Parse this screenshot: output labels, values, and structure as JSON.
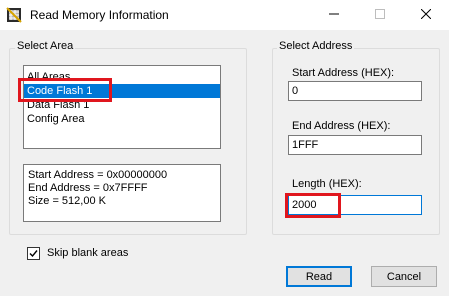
{
  "window": {
    "title": "Read Memory Information"
  },
  "select_area": {
    "title": "Select Area",
    "items": [
      {
        "label": "All Areas"
      },
      {
        "label": "Code Flash 1"
      },
      {
        "label": "Data Flash 1"
      },
      {
        "label": "Config Area"
      }
    ],
    "selected": "Code Flash 1",
    "info_lines": [
      "Start Address = 0x00000000",
      "End Address = 0x7FFFF",
      "Size = 512,00 K"
    ]
  },
  "select_address": {
    "title": "Select Address",
    "fields": [
      {
        "label": "Start Address (HEX):",
        "value": "0"
      },
      {
        "label": "End Address (HEX):",
        "value": "1FFF"
      },
      {
        "label": "Length (HEX):",
        "value": "2000"
      }
    ]
  },
  "options": {
    "skip_blank_label": "Skip blank areas",
    "skip_blank_checked": true
  },
  "buttons": {
    "read_label": "Read",
    "cancel_label": "Cancel"
  },
  "colors": {
    "selection": "#0078d7",
    "highlight": "#e0161e",
    "background": "#f0f0f0"
  },
  "icons": {
    "app": "memory-chip-icon",
    "minimize": "minimize-icon",
    "maximize": "maximize-icon",
    "close": "close-icon",
    "checkmark": "checkmark-icon"
  }
}
